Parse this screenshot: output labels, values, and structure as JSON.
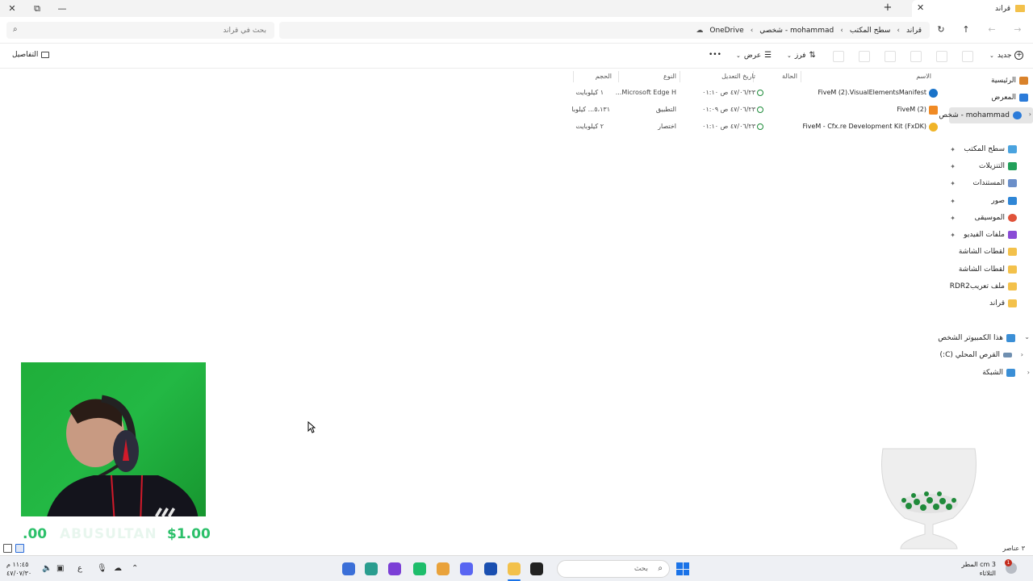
{
  "window": {
    "tab_title": "قراند",
    "minimize": "—",
    "maximize": "⧉",
    "close": "✕",
    "new_tab": "+",
    "tab_close": "✕"
  },
  "address": {
    "crumbs": [
      "قراند",
      "سطح المكتب",
      "mohammad - شخصي",
      "OneDrive"
    ],
    "separator": "›",
    "search_placeholder": "بحث في قراند"
  },
  "commands": {
    "new": "جديد",
    "sort": "فرز",
    "view": "عرض",
    "more": "•••",
    "details": "التفاصيل"
  },
  "columns": {
    "name": "الاسم",
    "status": "الحالة",
    "modified": "تاريخ التعديل",
    "type": "النوع",
    "size": "الحجم"
  },
  "files": [
    {
      "name": "FiveM (2).VisualElementsManifest",
      "modified": "٤٧/٠٦/٢٣ ص ٠١:١٠",
      "type": "Microsoft Edge H...",
      "size": "١ كيلوبايت",
      "icon_color": "#1a73c9"
    },
    {
      "name": "FiveM (2)",
      "modified": "٤٧/٠٦/٢٣ ص ٠١:٠٩",
      "type": "التطبيق",
      "size": "٥،١٣١... كيلوبا",
      "icon_color": "#f08a24"
    },
    {
      "name": "FiveM - Cfx.re Development Kit (FxDK)",
      "modified": "٤٧/٠٦/٢٣ ص ٠١:١٠",
      "type": "اختصار",
      "size": "٢ كيلوبايت",
      "icon_color": "#f0b428"
    }
  ],
  "sidebar": {
    "items": [
      {
        "label": "الرئيسية",
        "icon_color": "#d9822b"
      },
      {
        "label": "المعرض",
        "icon_color": "#2b7bd9"
      },
      {
        "label": "mohammad - شخص",
        "icon_color": "#2b7bd9"
      }
    ],
    "quick_access": [
      {
        "label": "سطح المكتب",
        "icon_color": "#4aa3df"
      },
      {
        "label": "التنزيلات",
        "icon_color": "#22a05a"
      },
      {
        "label": "المستندات",
        "icon_color": "#6b8fc9"
      },
      {
        "label": "صور",
        "icon_color": "#2f86d6"
      },
      {
        "label": "الموسيقى",
        "icon_color": "#e0533a"
      },
      {
        "label": "ملفات الفيديو",
        "icon_color": "#8a4bd6"
      },
      {
        "label": "لقطات الشاشة",
        "icon_color": "#f3c14b"
      },
      {
        "label": "لقطات الشاشة",
        "icon_color": "#f3c14b"
      },
      {
        "label": "ملف تعريبRDR2",
        "icon_color": "#f3c14b"
      },
      {
        "label": "قراند",
        "icon_color": "#f3c14b"
      }
    ],
    "this_pc": "هذا الكمبيوتر الشخص",
    "local_disk": "القرص المحلي (C:)",
    "network": "الشبكة"
  },
  "overlay": {
    "donation_left": ".00",
    "donation_ghost": "ABUSULTAN",
    "donation_right": "$1.00"
  },
  "status": {
    "item_count": "٣ عناصر"
  },
  "taskbar": {
    "search_placeholder": "بحث",
    "clock_time": "١١:٤٥ م",
    "clock_date": "٤٧/٠٧/٣٠",
    "weather_temp": "3 cm المطر",
    "weather_day": "الثلاثاء",
    "notif_count": "1",
    "lang": "ع",
    "apps": [
      "#3b6fd8",
      "#2a9d8f",
      "#7b3fd6",
      "#1ebd6b",
      "#e9a23b",
      "#5865f2",
      "#1a4fb0",
      "#f3c14b",
      "#222222"
    ]
  }
}
